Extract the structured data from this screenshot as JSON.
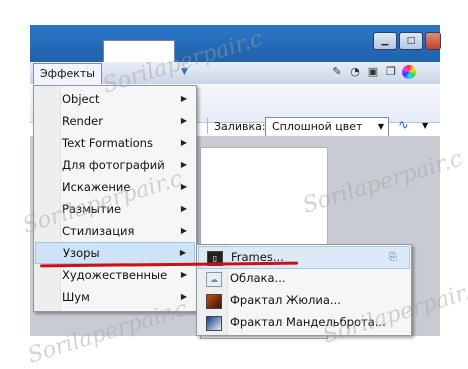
{
  "toolbar": {
    "effects_menu_label": "Эффекты"
  },
  "options_bar": {
    "fill_label": "Заливка:",
    "fill_value": "Сплошной цвет"
  },
  "main_menu": {
    "items": [
      {
        "label": "Object",
        "has_submenu": true
      },
      {
        "label": "Render",
        "has_submenu": true
      },
      {
        "label": "Text Formations",
        "has_submenu": true
      },
      {
        "label": "Для фотографий",
        "has_submenu": true
      },
      {
        "label": "Искажение",
        "has_submenu": true
      },
      {
        "label": "Размытие",
        "has_submenu": true
      },
      {
        "label": "Стилизация",
        "has_submenu": true
      },
      {
        "label": "Узоры",
        "has_submenu": true,
        "active": true
      },
      {
        "label": "Художественные",
        "has_submenu": true
      },
      {
        "label": "Шум",
        "has_submenu": true
      }
    ]
  },
  "sub_menu": {
    "items": [
      {
        "label": "Frames...",
        "icon": "frames-icon",
        "active": true
      },
      {
        "label": "Облака...",
        "icon": "clouds-icon"
      },
      {
        "label": "Фрактал Жюлиа...",
        "icon": "julia-fractal-icon"
      },
      {
        "label": "Фрактал Мандельброта...",
        "icon": "mandelbrot-fractal-icon"
      }
    ]
  },
  "watermark_text": "Sorilaperpair.c",
  "colors": {
    "highlight_border": "#9fc4ea",
    "annotation_underline": "#d01010",
    "titlebar": "#2d77c8"
  }
}
